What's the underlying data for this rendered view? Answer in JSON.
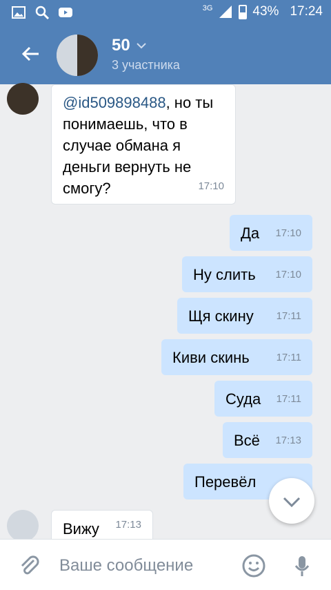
{
  "status_bar": {
    "network": "3G",
    "battery": "43%",
    "time": "17:24"
  },
  "header": {
    "title": "50",
    "subtitle": "3 участника"
  },
  "messages": [
    {
      "mention": "@id509898488",
      "text": ", но ты понимаешь, что в случае обмана я деньги вернуть не смогу?",
      "time": "17:10",
      "direction": "in"
    },
    {
      "text": "Да",
      "time": "17:10",
      "direction": "out"
    },
    {
      "text": "Ну слить",
      "time": "17:10",
      "direction": "out"
    },
    {
      "text": "Щя скину",
      "time": "17:11",
      "direction": "out"
    },
    {
      "text": "Киви скинь",
      "time": "17:11",
      "direction": "out"
    },
    {
      "text": "Суда",
      "time": "17:11",
      "direction": "out"
    },
    {
      "text": "Всё",
      "time": "17:13",
      "direction": "out"
    },
    {
      "text": "Перевёл",
      "time": "",
      "direction": "out"
    },
    {
      "text": "Вижу",
      "time": "17:13",
      "direction": "in"
    }
  ],
  "composer": {
    "placeholder": "Ваше сообщение"
  },
  "colors": {
    "header": "#5181b8",
    "outgoing_bubble": "#cce4ff",
    "background": "#edeef0"
  }
}
